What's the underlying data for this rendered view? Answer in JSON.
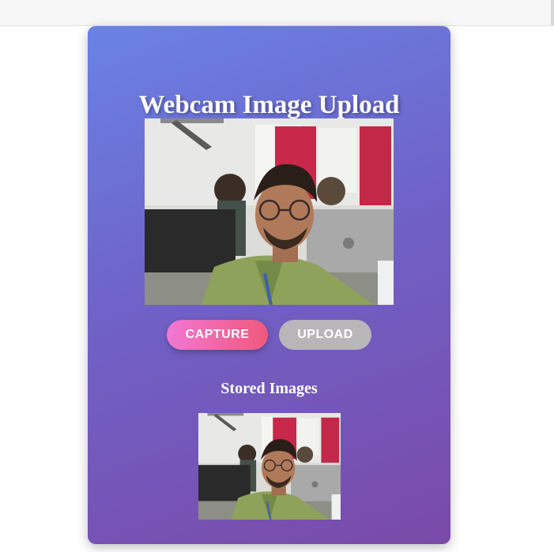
{
  "app": {
    "title": "Webcam Image Upload"
  },
  "controls": {
    "capture_label": "CAPTURE",
    "upload_label": "UPLOAD"
  },
  "stored": {
    "heading": "Stored Images",
    "count": 1
  },
  "colors": {
    "card_gradient_start": "#6a82e5",
    "card_gradient_end": "#7a4aa8",
    "capture_gradient_start": "#f177d3",
    "capture_gradient_end": "#f0597c",
    "upload_button": "#b8b6b9",
    "text": "#ffffff"
  }
}
